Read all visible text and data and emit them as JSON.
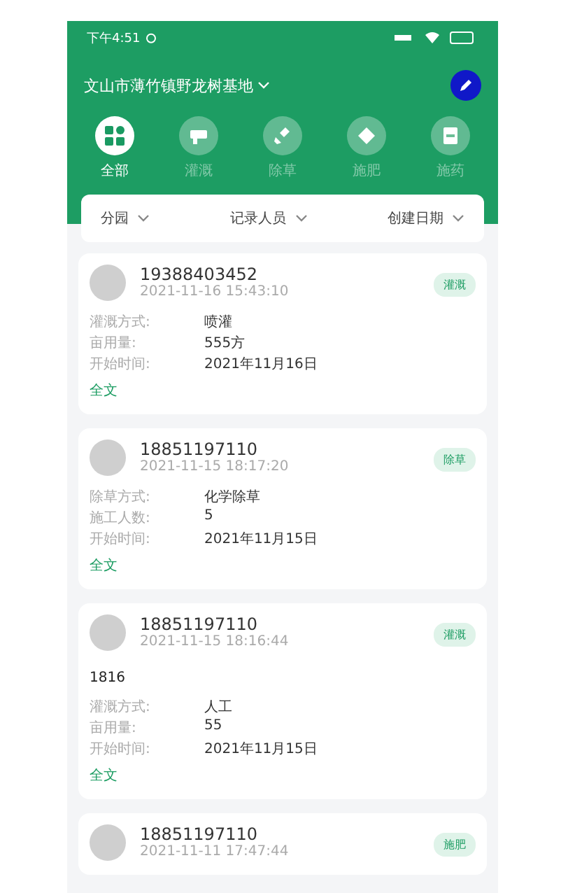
{
  "status_bar": {
    "time": "下午4:51"
  },
  "location": {
    "name": "文山市薄竹镇野龙树基地"
  },
  "categories": [
    {
      "label": "全部",
      "kind": "all",
      "selected": true
    },
    {
      "label": "灌溉",
      "kind": "irrigate",
      "selected": false
    },
    {
      "label": "除草",
      "kind": "weed",
      "selected": false
    },
    {
      "label": "施肥",
      "kind": "fertilize",
      "selected": false
    },
    {
      "label": "施药",
      "kind": "pesticide",
      "selected": false
    }
  ],
  "filters": [
    "分园",
    "记录人员",
    "创建日期"
  ],
  "records": [
    {
      "user": "19388403452",
      "time": "2021-11-16 15:43:10",
      "tag": "灌溉",
      "fields": [
        {
          "label": "灌溉方式:",
          "value": "喷灌"
        },
        {
          "label": "亩用量:",
          "value": "555方"
        },
        {
          "label": "开始时间:",
          "value": "2021年11月16日"
        }
      ],
      "more": "全文"
    },
    {
      "user": "18851197110",
      "time": "2021-11-15 18:17:20",
      "tag": "除草",
      "fields": [
        {
          "label": "除草方式:",
          "value": "化学除草"
        },
        {
          "label": "施工人数:",
          "value": "5"
        },
        {
          "label": "开始时间:",
          "value": "2021年11月15日"
        }
      ],
      "more": "全文"
    },
    {
      "user": "18851197110",
      "time": "2021-11-15 18:16:44",
      "tag": "灌溉",
      "note": "1816",
      "fields": [
        {
          "label": "灌溉方式:",
          "value": "人工"
        },
        {
          "label": "亩用量:",
          "value": "55"
        },
        {
          "label": "开始时间:",
          "value": "2021年11月15日"
        }
      ],
      "more": "全文"
    },
    {
      "user": "18851197110",
      "time": "2021-11-11 17:47:44",
      "tag": "施肥"
    }
  ]
}
